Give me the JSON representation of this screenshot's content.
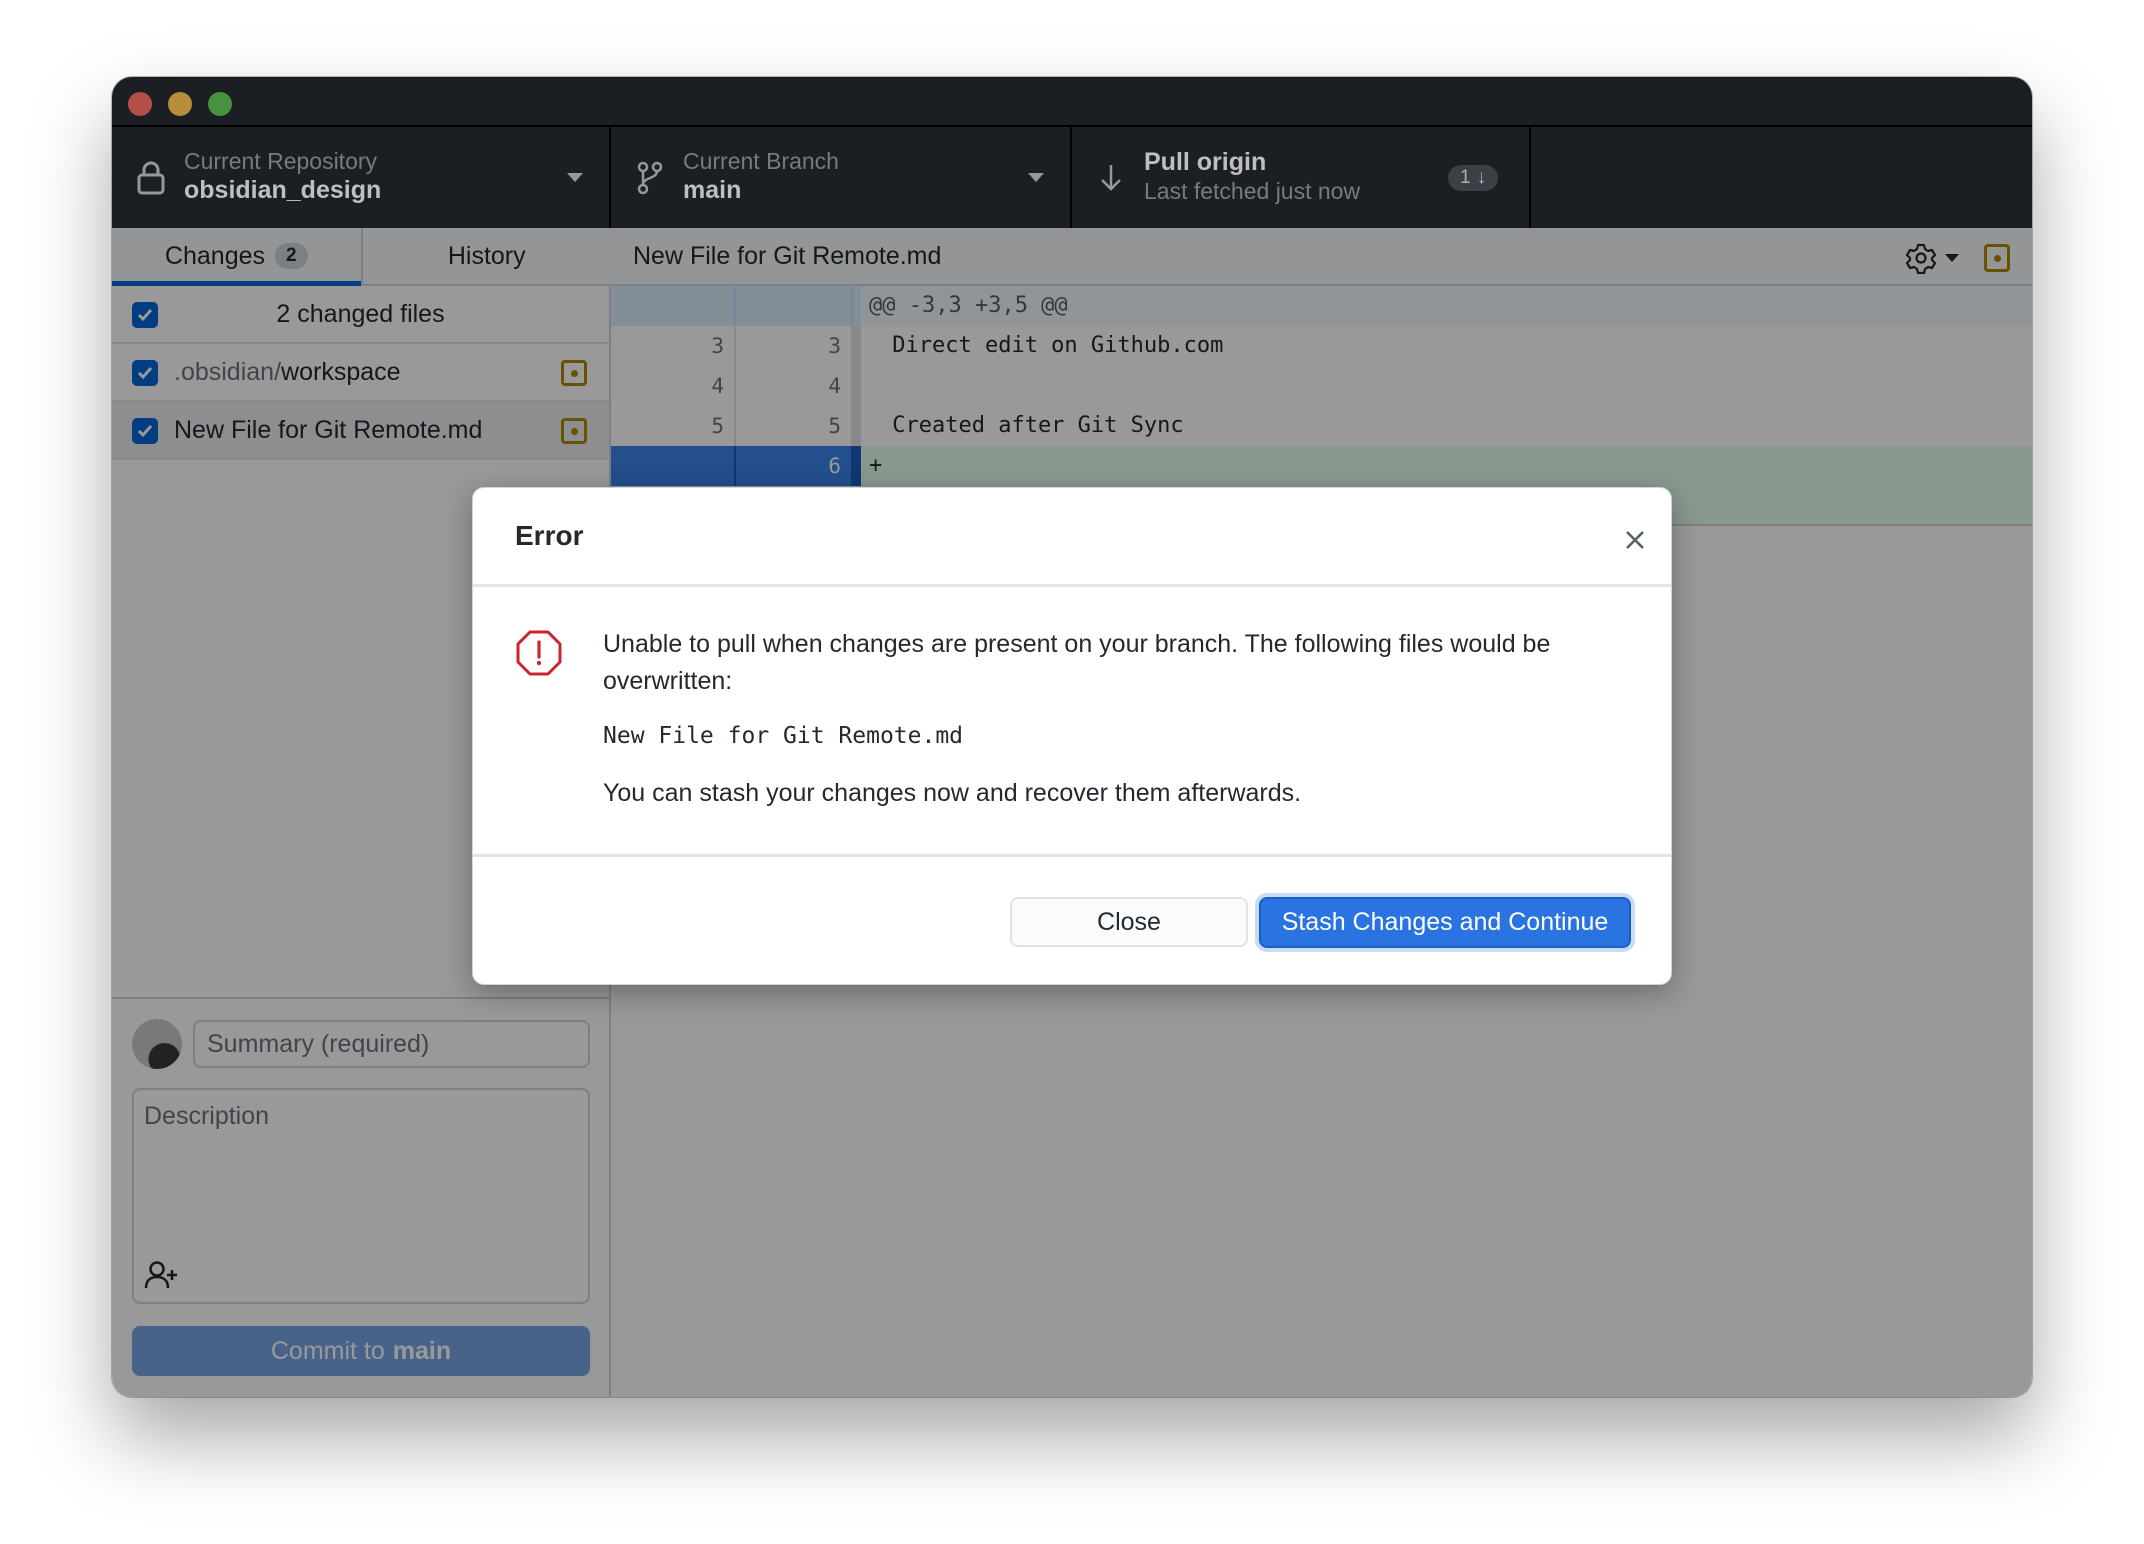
{
  "window": {
    "controls": [
      "close",
      "minimize",
      "zoom"
    ]
  },
  "toolbar": {
    "repository": {
      "label": "Current Repository",
      "value": "obsidian_design",
      "icon": "lock-icon"
    },
    "branch": {
      "label": "Current Branch",
      "value": "main",
      "icon": "git-branch-icon"
    },
    "pull": {
      "title": "Pull origin",
      "subtitle": "Last fetched just now",
      "badge_count": "1",
      "badge_icon": "↓",
      "icon": "arrow-down-icon"
    }
  },
  "sidebar": {
    "tabs": [
      {
        "label": "Changes",
        "count": "2",
        "active": true
      },
      {
        "label": "History",
        "active": false
      }
    ],
    "changes_header": "2 changed files",
    "files": [
      {
        "dir": ".obsidian/",
        "name": "workspace",
        "checked": true,
        "status": "modified",
        "selected": false
      },
      {
        "dir": "",
        "name": "New File for Git Remote.md",
        "checked": true,
        "status": "modified",
        "selected": true
      }
    ],
    "commit": {
      "summary_placeholder": "Summary (required)",
      "description_placeholder": "Description",
      "button_prefix": "Commit to",
      "button_branch": "main"
    }
  },
  "diff": {
    "file_title": "New File for Git Remote.md",
    "hunk_header": "@@ -3,3 +3,5 @@",
    "lines": [
      {
        "old": "3",
        "new": "3",
        "text": " Direct edit on Github.com",
        "type": "context"
      },
      {
        "old": "4",
        "new": "4",
        "text": "",
        "type": "context"
      },
      {
        "old": "5",
        "new": "5",
        "text": " Created after Git Sync",
        "type": "context"
      },
      {
        "old": "",
        "new": "6",
        "text": "+",
        "type": "added"
      }
    ]
  },
  "dialog": {
    "title": "Error",
    "message": "Unable to pull when changes are present on your branch. The following files would be overwritten:",
    "file": "New File for Git Remote.md",
    "hint": "You can stash your changes now and recover them afterwards.",
    "close_label": "Close",
    "primary_label": "Stash Changes and Continue",
    "colors": {
      "primary": "#2a74e2",
      "error_icon": "#cb2431"
    }
  }
}
